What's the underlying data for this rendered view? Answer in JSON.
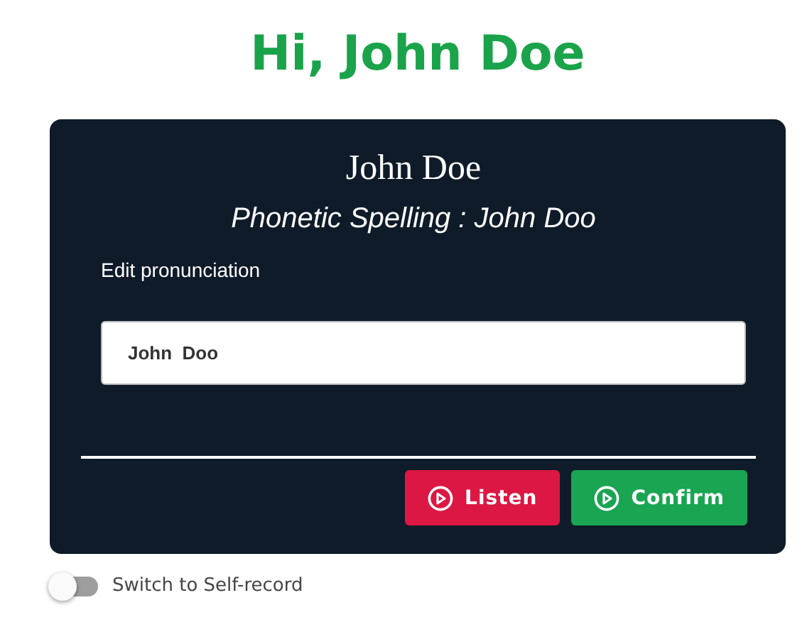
{
  "greeting": "Hi, John Doe",
  "card": {
    "name": "John Doe",
    "phonetic": "Phonetic Spelling : John Doo",
    "field_label": "Edit pronunciation",
    "field_value": "John  Doo",
    "buttons": [
      {
        "label": "Listen",
        "color": "#dc1743"
      },
      {
        "label": "Confirm",
        "color": "#19a552"
      }
    ]
  },
  "toggle": {
    "label": "Switch to Self-record",
    "on": false
  }
}
